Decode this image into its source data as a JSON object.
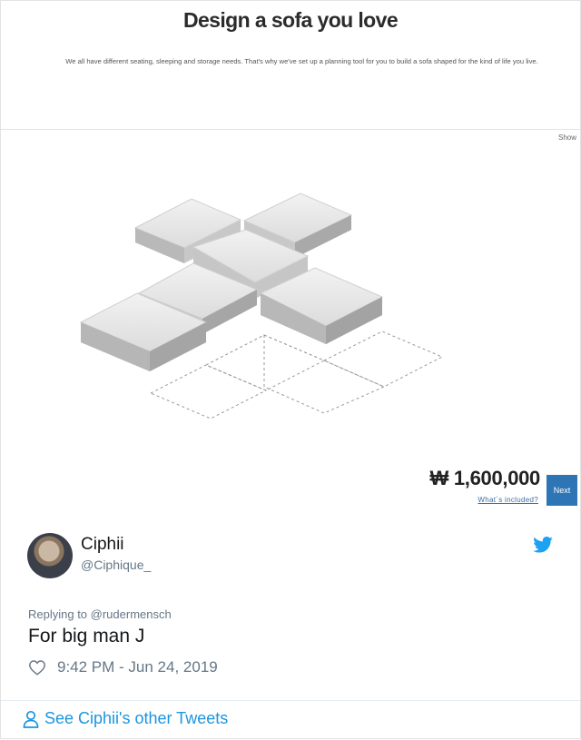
{
  "header": {
    "title": "Design a sofa you love",
    "description": "We all have different seating, sleeping and storage needs. That's why we've set up a planning tool for you to build a sofa shaped for the kind of life you live."
  },
  "configurator": {
    "show_label": "Show",
    "price": "₩ 1,600,000",
    "included_label": "What´s included?",
    "next_label": "Next"
  },
  "tweet": {
    "display_name": "Ciphii",
    "handle": "@Ciphique_",
    "reply_to": "Replying to @rudermensch",
    "text": "For big man J",
    "timestamp": "9:42 PM - Jun 24, 2019",
    "see_more": "See Ciphii's other Tweets"
  },
  "colors": {
    "twitter_blue": "#1da1f2",
    "next_button": "#2e75b6"
  },
  "icons": [
    "twitter-bird-icon",
    "heart-icon",
    "person-icon"
  ]
}
